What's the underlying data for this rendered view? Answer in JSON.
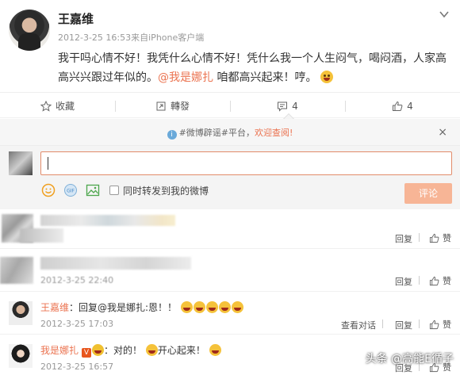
{
  "post": {
    "author": "王嘉维",
    "meta": "2012-3-25 16:53来自iPhone客户端",
    "text_a": "我干吗心情不好！我凭什么心情不好！凭什么我一个人生闷气，喝闷酒，人家高高兴兴跟过年似的。",
    "mention": "@我是娜扎",
    "text_b": " 咱都高兴起来！哼。"
  },
  "actions": {
    "favorite": "收藏",
    "repost": "轉發",
    "comments": "4",
    "likes": "4"
  },
  "notice": {
    "prefix": "#微博辟谣#平台，",
    "link": "欢迎查阅!",
    "close": "×"
  },
  "composer": {
    "sync_label": "同时转发到我的微博",
    "submit": "评论"
  },
  "comments": [
    {
      "text": "",
      "time": "",
      "reply": "回复",
      "like": "赞"
    },
    {
      "text": "",
      "time": "2012-3-25 22:40",
      "reply": "回复",
      "like": "赞"
    },
    {
      "author": "王嘉维",
      "text": "：回复@我是娜扎:恩！！",
      "time": "2012-3-25 17:03",
      "thread": "查看对话",
      "reply": "回复",
      "like": "赞"
    },
    {
      "author": "我是娜扎",
      "text": "：对的！",
      "text_b": "开心起来！",
      "time": "2012-3-25 16:57",
      "reply": "回复",
      "like": "赞"
    }
  ],
  "watermark": "头条 @高能E循子",
  "colors": {
    "accent": "#eb7350",
    "submit": "#f7b596",
    "notice_bg": "#f6f6f6"
  }
}
